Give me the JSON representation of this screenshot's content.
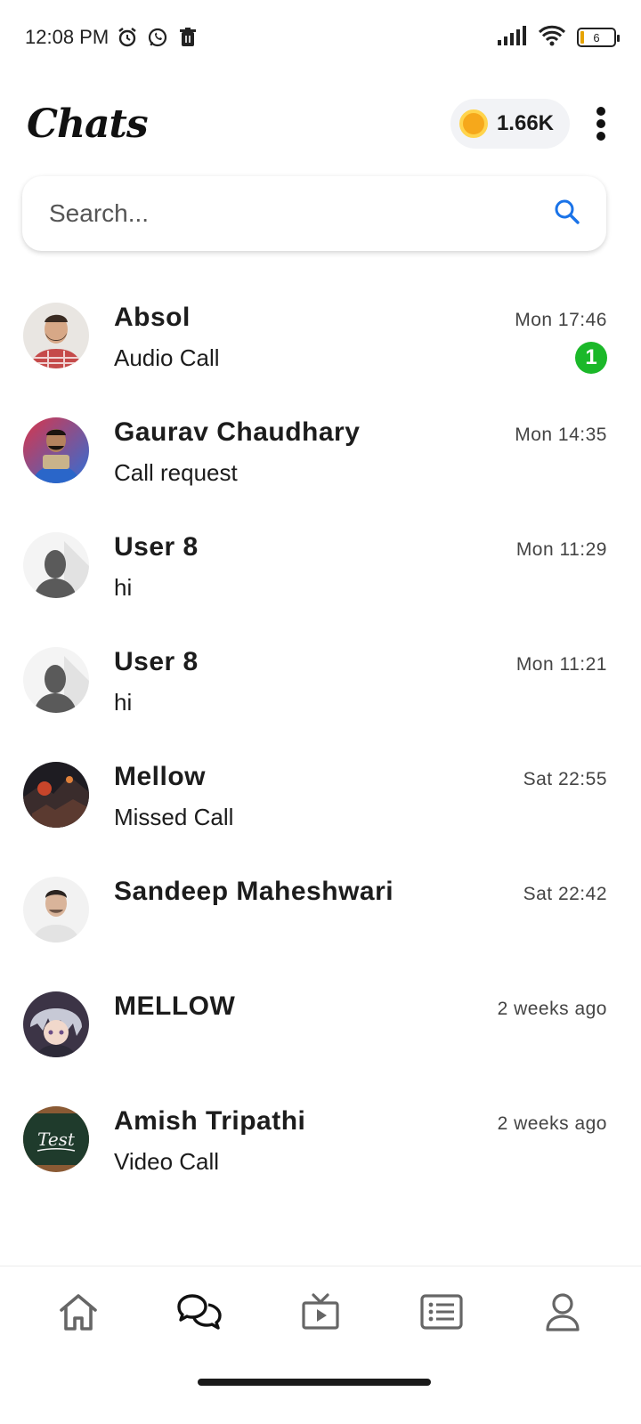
{
  "status_bar": {
    "time": "12:08 PM",
    "battery": "6",
    "icons": [
      "alarm-icon",
      "whatsapp-icon",
      "trash-icon",
      "signal-icon",
      "wifi-icon",
      "battery-icon"
    ]
  },
  "header": {
    "title": "Chats",
    "coins": "1.66K",
    "coin_color": "#f6a81b"
  },
  "search": {
    "placeholder": "Search...",
    "value": "",
    "icon": "search-icon",
    "icon_color": "#1a73e8"
  },
  "chats": [
    {
      "name": "Absol",
      "message": "Audio Call",
      "time": "Mon 17:46",
      "unread": "1",
      "avatar": "photo"
    },
    {
      "name": "Gaurav Chaudhary",
      "message": "Call request",
      "time": "Mon 14:35",
      "unread": "",
      "avatar": "photo"
    },
    {
      "name": "User 8",
      "message": "hi",
      "time": "Mon 11:29",
      "unread": "",
      "avatar": "placeholder"
    },
    {
      "name": "User 8",
      "message": "hi",
      "time": "Mon 11:21",
      "unread": "",
      "avatar": "placeholder"
    },
    {
      "name": "Mellow",
      "message": "Missed Call",
      "time": "Sat 22:55",
      "unread": "",
      "avatar": "photo"
    },
    {
      "name": "Sandeep Maheshwari",
      "message": "",
      "time": "Sat 22:42",
      "unread": "",
      "avatar": "photo"
    },
    {
      "name": "MELLOW",
      "message": "",
      "time": "2 weeks ago",
      "unread": "",
      "avatar": "photo"
    },
    {
      "name": "Amish Tripathi",
      "message": "Video Call",
      "time": "2 weeks ago",
      "unread": "",
      "avatar": "image-with-text",
      "avatar_text": "Test"
    }
  ],
  "unread_badge_color": "#1bb829",
  "bottom_nav": {
    "items": [
      "home-icon",
      "chats-icon",
      "tv-icon",
      "list-icon",
      "profile-icon"
    ],
    "active": "chats-icon"
  }
}
